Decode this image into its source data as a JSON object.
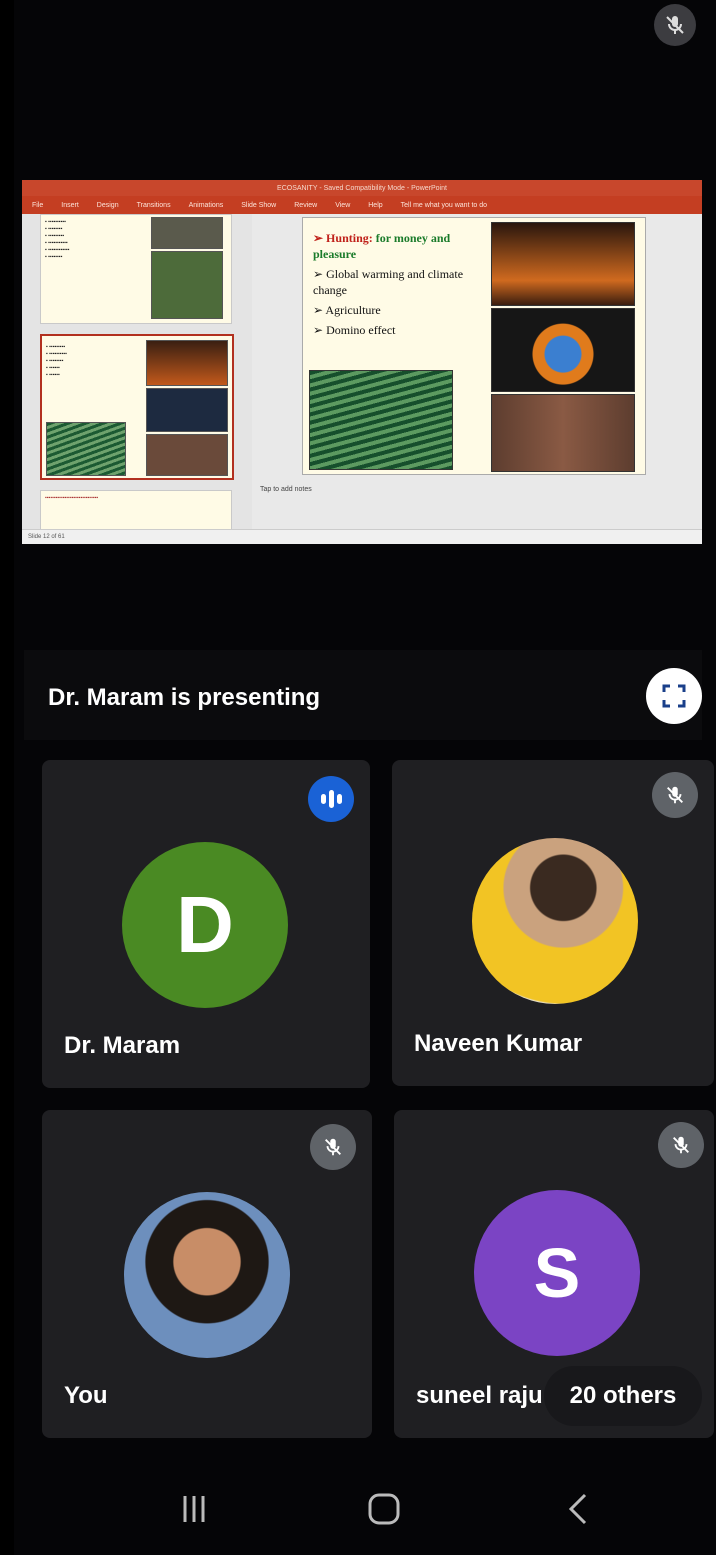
{
  "presentation": {
    "app_title": "ECOSANITY - Saved Compatibility Mode - PowerPoint",
    "ribbon_tabs": [
      "File",
      "Insert",
      "Design",
      "Transitions",
      "Animations",
      "Slide Show",
      "Review",
      "View",
      "Help",
      "Tell me what you want to do"
    ],
    "main_slide_bullets": [
      {
        "prefix": "➢ Hunting: ",
        "text": "for money and pleasure"
      },
      {
        "prefix": "➢ ",
        "text": "Global warming and climate change"
      },
      {
        "prefix": "➢ ",
        "text": "Agriculture"
      },
      {
        "prefix": "➢ ",
        "text": "Domino effect"
      }
    ],
    "notes_placeholder": "Tap to add notes",
    "status_left": "Slide 12 of 61"
  },
  "presenter_banner": {
    "text": "Dr. Maram is presenting"
  },
  "participants": [
    {
      "name": "Dr. Maram",
      "initial": "D",
      "avatar_color": "#4a8a23",
      "speaking": true
    },
    {
      "name": "Naveen Kumar",
      "muted": true
    },
    {
      "name": "You",
      "muted": true
    },
    {
      "name": "suneel raju",
      "initial": "S",
      "avatar_color": "#7b44c4",
      "muted": true
    }
  ],
  "others_count": "20 others",
  "colors": {
    "accent_blue": "#1a62d6",
    "tile_bg": "#1f1f22"
  }
}
